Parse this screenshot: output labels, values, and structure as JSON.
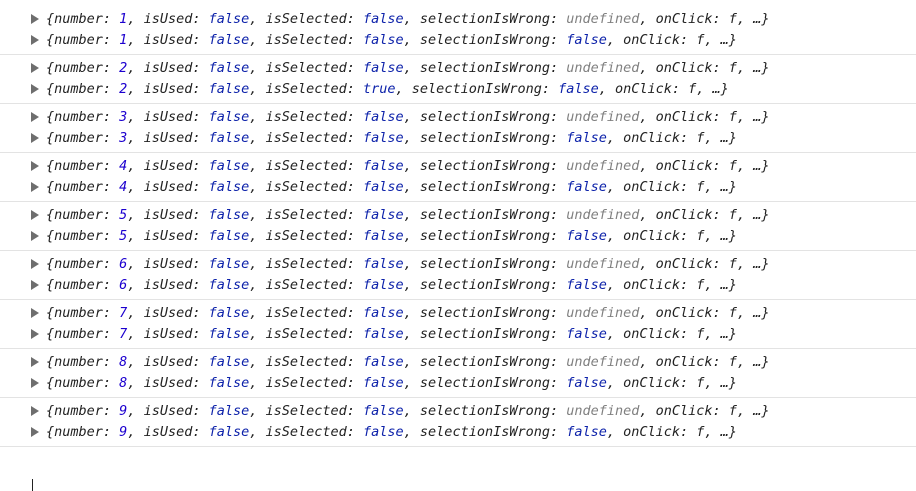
{
  "console": {
    "entries": [
      {
        "pairs": [
          {
            "number": "1",
            "isUsed": "false",
            "isSelected": "false",
            "selectionIsWrong": "undefined",
            "wrongUndef": true
          },
          {
            "number": "1",
            "isUsed": "false",
            "isSelected": "false",
            "selectionIsWrong": "false",
            "wrongUndef": false
          }
        ]
      },
      {
        "pairs": [
          {
            "number": "2",
            "isUsed": "false",
            "isSelected": "false",
            "selectionIsWrong": "undefined",
            "wrongUndef": true
          },
          {
            "number": "2",
            "isUsed": "false",
            "isSelected": "true",
            "selectionIsWrong": "false",
            "wrongUndef": false
          }
        ]
      },
      {
        "pairs": [
          {
            "number": "3",
            "isUsed": "false",
            "isSelected": "false",
            "selectionIsWrong": "undefined",
            "wrongUndef": true
          },
          {
            "number": "3",
            "isUsed": "false",
            "isSelected": "false",
            "selectionIsWrong": "false",
            "wrongUndef": false
          }
        ]
      },
      {
        "pairs": [
          {
            "number": "4",
            "isUsed": "false",
            "isSelected": "false",
            "selectionIsWrong": "undefined",
            "wrongUndef": true
          },
          {
            "number": "4",
            "isUsed": "false",
            "isSelected": "false",
            "selectionIsWrong": "false",
            "wrongUndef": false
          }
        ]
      },
      {
        "pairs": [
          {
            "number": "5",
            "isUsed": "false",
            "isSelected": "false",
            "selectionIsWrong": "undefined",
            "wrongUndef": true
          },
          {
            "number": "5",
            "isUsed": "false",
            "isSelected": "false",
            "selectionIsWrong": "false",
            "wrongUndef": false
          }
        ]
      },
      {
        "pairs": [
          {
            "number": "6",
            "isUsed": "false",
            "isSelected": "false",
            "selectionIsWrong": "undefined",
            "wrongUndef": true
          },
          {
            "number": "6",
            "isUsed": "false",
            "isSelected": "false",
            "selectionIsWrong": "false",
            "wrongUndef": false
          }
        ]
      },
      {
        "pairs": [
          {
            "number": "7",
            "isUsed": "false",
            "isSelected": "false",
            "selectionIsWrong": "undefined",
            "wrongUndef": true
          },
          {
            "number": "7",
            "isUsed": "false",
            "isSelected": "false",
            "selectionIsWrong": "false",
            "wrongUndef": false
          }
        ]
      },
      {
        "pairs": [
          {
            "number": "8",
            "isUsed": "false",
            "isSelected": "false",
            "selectionIsWrong": "undefined",
            "wrongUndef": true
          },
          {
            "number": "8",
            "isUsed": "false",
            "isSelected": "false",
            "selectionIsWrong": "false",
            "wrongUndef": false
          }
        ]
      },
      {
        "pairs": [
          {
            "number": "9",
            "isUsed": "false",
            "isSelected": "false",
            "selectionIsWrong": "undefined",
            "wrongUndef": true
          },
          {
            "number": "9",
            "isUsed": "false",
            "isSelected": "false",
            "selectionIsWrong": "false",
            "wrongUndef": false
          }
        ]
      }
    ],
    "labels": {
      "open": "{",
      "number": "number: ",
      "isUsed": ", isUsed: ",
      "isSelected": ", isSelected: ",
      "selectionIsWrong": ", selectionIsWrong: ",
      "onClick": ", onClick: ",
      "f": "f",
      "rest": ", …}"
    },
    "icons": {
      "expand": "triangle-right-icon"
    },
    "colors": {
      "number": "#1c00cf",
      "boolean": "#0d22aa",
      "undefined": "#808080"
    }
  }
}
